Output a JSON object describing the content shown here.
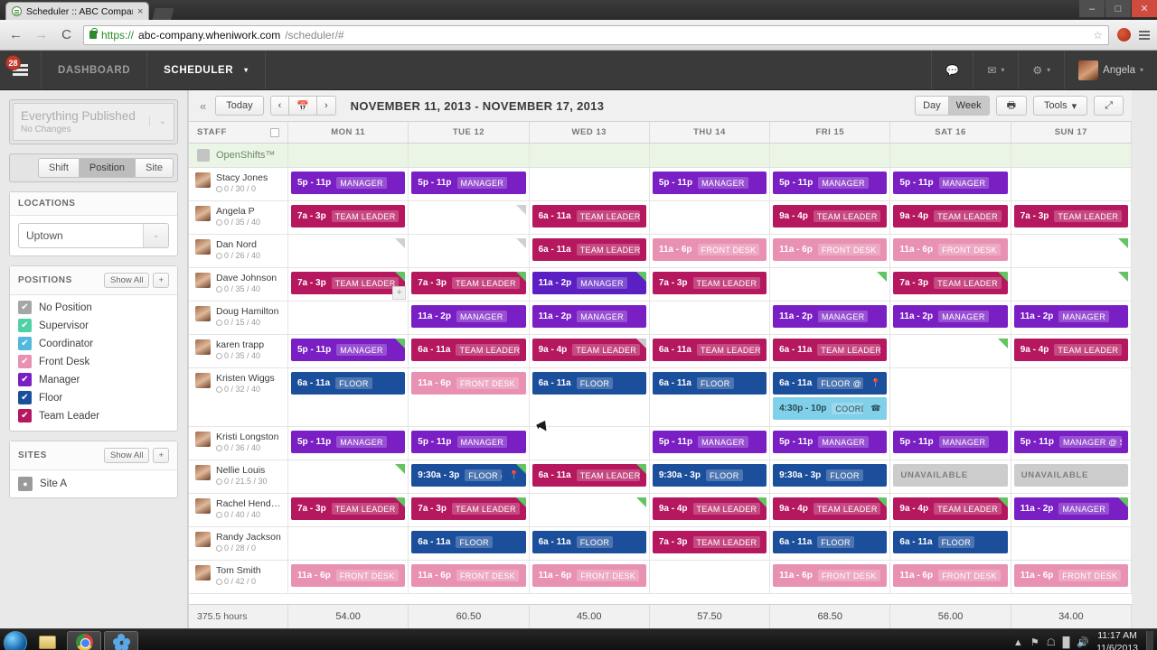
{
  "browser": {
    "tab_title": "Scheduler :: ABC Compan",
    "tab_close": "×",
    "url_scheme": "https://",
    "url_host": "abc-company.wheniwork.com",
    "url_path": "/scheduler/#",
    "back_icon": "←",
    "forward_icon": "→",
    "reload_icon": "C",
    "star_icon": "☆",
    "minimize": "–",
    "maximize": "□",
    "close": "✕"
  },
  "app_header": {
    "badge": "28",
    "nav": [
      {
        "label": "DASHBOARD",
        "active": false
      },
      {
        "label": "SCHEDULER",
        "active": true,
        "caret": "▾"
      }
    ],
    "chat_icon": "⌨",
    "inbox_icon": "✉",
    "gear_icon": "⚙",
    "caret": "▾",
    "user_name": "Angela"
  },
  "sidebar": {
    "publish": {
      "title": "Everything Published",
      "subtitle": "No Changes",
      "caret": "⌄"
    },
    "view_modes": [
      {
        "label": "Shift",
        "active": false
      },
      {
        "label": "Position",
        "active": true
      },
      {
        "label": "Site",
        "active": false
      }
    ],
    "locations": {
      "header": "LOCATIONS",
      "selected": "Uptown",
      "caret": "⌄"
    },
    "positions": {
      "header": "POSITIONS",
      "show_all": "Show All",
      "add": "+",
      "items": [
        {
          "label": "No Position",
          "color": "#a6a6a6",
          "checked": true
        },
        {
          "label": "Supervisor",
          "color": "#4fd0a5",
          "checked": true
        },
        {
          "label": "Coordinator",
          "color": "#52b8dd",
          "checked": true
        },
        {
          "label": "Front Desk",
          "color": "#e891b3",
          "checked": true
        },
        {
          "label": "Manager",
          "color": "#7a1fc4",
          "checked": true
        },
        {
          "label": "Floor",
          "color": "#1b4f9c",
          "checked": true
        },
        {
          "label": "Team Leader",
          "color": "#b5185e",
          "checked": true
        }
      ]
    },
    "sites": {
      "header": "SITES",
      "show_all": "Show All",
      "add": "+",
      "items": [
        {
          "label": "Site A",
          "icon": "📍"
        }
      ]
    }
  },
  "toolbar": {
    "collapse_icon": "«",
    "today": "Today",
    "prev": "‹",
    "next": "›",
    "calendar_icon": "▦",
    "date_range": "NOVEMBER 11, 2013 - NOVEMBER 17, 2013",
    "day": "Day",
    "week": "Week",
    "print_icon": "⎙",
    "tools": "Tools",
    "tools_caret": "▾",
    "expand_icon": "⤢"
  },
  "grid": {
    "staff_header": "STAFF",
    "days": [
      "MON 11",
      "TUE 12",
      "WED 13",
      "THU 14",
      "FRI 15",
      "SAT 16",
      "SUN 17"
    ],
    "open_shifts_label": "OpenShifts™",
    "clock_icon": "◴",
    "pin_icon": "📍",
    "phone_icon": "☎",
    "rows": [
      {
        "name": "Stacy Jones",
        "hours": "0 / 30 / 0",
        "cells": [
          {
            "shifts": [
              {
                "time": "5p - 11p",
                "position": "MANAGER",
                "color": "#7a1fc4"
              }
            ]
          },
          {
            "shifts": [
              {
                "time": "5p - 11p",
                "position": "MANAGER",
                "color": "#7a1fc4"
              }
            ]
          },
          {
            "shifts": []
          },
          {
            "shifts": [
              {
                "time": "5p - 11p",
                "position": "MANAGER",
                "color": "#7a1fc4"
              }
            ]
          },
          {
            "shifts": [
              {
                "time": "5p - 11p",
                "position": "MANAGER",
                "color": "#7a1fc4"
              }
            ]
          },
          {
            "shifts": [
              {
                "time": "5p - 11p",
                "position": "MANAGER",
                "color": "#7a1fc4"
              }
            ]
          },
          {
            "shifts": []
          }
        ]
      },
      {
        "name": "Angela P",
        "hours": "0 / 35 / 40",
        "cells": [
          {
            "shifts": [
              {
                "time": "7a - 3p",
                "position": "TEAM LEADER",
                "color": "#b5185e"
              }
            ]
          },
          {
            "shifts": [],
            "corner": "grey"
          },
          {
            "shifts": [
              {
                "time": "6a - 11a",
                "position": "TEAM LEADER",
                "color": "#b5185e"
              }
            ]
          },
          {
            "shifts": []
          },
          {
            "shifts": [
              {
                "time": "9a - 4p",
                "position": "TEAM LEADER",
                "color": "#b5185e"
              }
            ]
          },
          {
            "shifts": [
              {
                "time": "9a - 4p",
                "position": "TEAM LEADER",
                "color": "#b5185e"
              }
            ]
          },
          {
            "shifts": [
              {
                "time": "7a - 3p",
                "position": "TEAM LEADER",
                "color": "#b5185e"
              }
            ]
          }
        ]
      },
      {
        "name": "Dan Nord",
        "hours": "0 / 26 / 40",
        "cells": [
          {
            "shifts": [],
            "corner": "grey"
          },
          {
            "shifts": [],
            "corner": "grey"
          },
          {
            "shifts": [
              {
                "time": "6a - 11a",
                "position": "TEAM LEADER",
                "color": "#b5185e"
              }
            ]
          },
          {
            "shifts": [
              {
                "time": "11a - 6p",
                "position": "FRONT DESK",
                "color": "#e891b3"
              }
            ]
          },
          {
            "shifts": [
              {
                "time": "11a - 6p",
                "position": "FRONT DESK",
                "color": "#e891b3"
              }
            ]
          },
          {
            "shifts": [
              {
                "time": "11a - 6p",
                "position": "FRONT DESK",
                "color": "#e891b3"
              }
            ]
          },
          {
            "shifts": [],
            "corner": "green"
          }
        ]
      },
      {
        "name": "Dave Johnson",
        "hours": "0 / 35 / 40",
        "cells": [
          {
            "shifts": [
              {
                "time": "7a - 3p",
                "position": "TEAM LEADER",
                "color": "#b5185e",
                "corner": "green"
              }
            ],
            "add": "+"
          },
          {
            "shifts": [
              {
                "time": "7a - 3p",
                "position": "TEAM LEADER",
                "color": "#b5185e",
                "corner": "green"
              }
            ]
          },
          {
            "shifts": [
              {
                "time": "11a - 2p",
                "position": "MANAGER",
                "color": "#5b1fc4",
                "corner": "green"
              }
            ]
          },
          {
            "shifts": [
              {
                "time": "7a - 3p",
                "position": "TEAM LEADER",
                "color": "#b5185e"
              }
            ]
          },
          {
            "shifts": [],
            "corner": "green"
          },
          {
            "shifts": [
              {
                "time": "7a - 3p",
                "position": "TEAM LEADER",
                "color": "#b5185e",
                "corner": "green"
              }
            ]
          },
          {
            "shifts": [],
            "corner": "green"
          }
        ]
      },
      {
        "name": "Doug Hamilton",
        "hours": "0 / 15 / 40",
        "cells": [
          {
            "shifts": []
          },
          {
            "shifts": [
              {
                "time": "11a - 2p",
                "position": "MANAGER",
                "color": "#7a1fc4"
              }
            ]
          },
          {
            "shifts": [
              {
                "time": "11a - 2p",
                "position": "MANAGER",
                "color": "#7a1fc4"
              }
            ]
          },
          {
            "shifts": []
          },
          {
            "shifts": [
              {
                "time": "11a - 2p",
                "position": "MANAGER",
                "color": "#7a1fc4"
              }
            ]
          },
          {
            "shifts": [
              {
                "time": "11a - 2p",
                "position": "MANAGER",
                "color": "#7a1fc4"
              }
            ]
          },
          {
            "shifts": [
              {
                "time": "11a - 2p",
                "position": "MANAGER",
                "color": "#7a1fc4"
              }
            ]
          }
        ]
      },
      {
        "name": "karen trapp",
        "hours": "0 / 35 / 40",
        "cells": [
          {
            "shifts": [
              {
                "time": "5p - 11p",
                "position": "MANAGER",
                "color": "#7a1fc4",
                "corner": "green"
              }
            ]
          },
          {
            "shifts": [
              {
                "time": "6a - 11a",
                "position": "TEAM LEADER @ SIT",
                "color": "#b5185e"
              }
            ]
          },
          {
            "shifts": [
              {
                "time": "9a - 4p",
                "position": "TEAM LEADER",
                "color": "#b5185e",
                "corner": "grey"
              }
            ]
          },
          {
            "shifts": [
              {
                "time": "6a - 11a",
                "position": "TEAM LEADER",
                "color": "#b5185e"
              }
            ]
          },
          {
            "shifts": [
              {
                "time": "6a - 11a",
                "position": "TEAM LEADER",
                "color": "#b5185e"
              }
            ]
          },
          {
            "shifts": [],
            "corner": "green"
          },
          {
            "shifts": [
              {
                "time": "9a - 4p",
                "position": "TEAM LEADER",
                "color": "#b5185e"
              }
            ]
          }
        ]
      },
      {
        "name": "Kristen Wiggs",
        "hours": "0 / 32 / 40",
        "tall": true,
        "cells": [
          {
            "shifts": [
              {
                "time": "6a - 11a",
                "position": "FLOOR",
                "color": "#1b4f9c"
              }
            ]
          },
          {
            "shifts": [
              {
                "time": "11a - 6p",
                "position": "FRONT DESK",
                "color": "#e891b3"
              }
            ]
          },
          {
            "shifts": [
              {
                "time": "6a - 11a",
                "position": "FLOOR",
                "color": "#1b4f9c"
              }
            ]
          },
          {
            "shifts": [
              {
                "time": "6a - 11a",
                "position": "FLOOR",
                "color": "#1b4f9c"
              }
            ]
          },
          {
            "shifts": [
              {
                "time": "6a - 11a",
                "position": "FLOOR @ SITE A",
                "color": "#1b4f9c",
                "icon": "📍"
              },
              {
                "time": "4:30p - 10p",
                "position": "COORDINATOR",
                "color": "#7fd0e8",
                "icon": "☎",
                "dark_text": true
              }
            ]
          },
          {
            "shifts": []
          },
          {
            "shifts": []
          }
        ]
      },
      {
        "name": "Kristi Longston",
        "hours": "0 / 36 / 40",
        "cells": [
          {
            "shifts": [
              {
                "time": "5p - 11p",
                "position": "MANAGER",
                "color": "#7a1fc4"
              }
            ]
          },
          {
            "shifts": [
              {
                "time": "5p - 11p",
                "position": "MANAGER",
                "color": "#7a1fc4"
              }
            ]
          },
          {
            "shifts": []
          },
          {
            "shifts": [
              {
                "time": "5p - 11p",
                "position": "MANAGER",
                "color": "#7a1fc4"
              }
            ]
          },
          {
            "shifts": [
              {
                "time": "5p - 11p",
                "position": "MANAGER",
                "color": "#7a1fc4"
              }
            ]
          },
          {
            "shifts": [
              {
                "time": "5p - 11p",
                "position": "MANAGER",
                "color": "#7a1fc4"
              }
            ]
          },
          {
            "shifts": [
              {
                "time": "5p - 11p",
                "position": "MANAGER @ SITE A",
                "color": "#7a1fc4"
              }
            ]
          }
        ]
      },
      {
        "name": "Nellie Louis",
        "hours": "0 / 21.5 / 30",
        "cells": [
          {
            "shifts": [],
            "corner": "green"
          },
          {
            "shifts": [
              {
                "time": "9:30a - 3p",
                "position": "FLOOR @ SITE A",
                "color": "#1b4f9c",
                "icon": "📍",
                "corner": "green"
              }
            ]
          },
          {
            "shifts": [
              {
                "time": "6a - 11a",
                "position": "TEAM LEADER",
                "color": "#b5185e",
                "corner": "green"
              }
            ]
          },
          {
            "shifts": [
              {
                "time": "9:30a - 3p",
                "position": "FLOOR",
                "color": "#1b4f9c"
              }
            ]
          },
          {
            "shifts": [
              {
                "time": "9:30a - 3p",
                "position": "FLOOR",
                "color": "#1b4f9c"
              }
            ]
          },
          {
            "shifts": [
              {
                "unavailable": "UNAVAILABLE"
              }
            ]
          },
          {
            "shifts": [
              {
                "unavailable": "UNAVAILABLE"
              }
            ]
          }
        ]
      },
      {
        "name": "Rachel Henderson",
        "hours": "0 / 40 / 40",
        "cells": [
          {
            "shifts": [
              {
                "time": "7a - 3p",
                "position": "TEAM LEADER @ SITE",
                "color": "#b5185e",
                "corner": "green"
              }
            ]
          },
          {
            "shifts": [
              {
                "time": "7a - 3p",
                "position": "TEAM LEADER",
                "color": "#b5185e",
                "corner": "green"
              }
            ]
          },
          {
            "shifts": [],
            "corner": "green"
          },
          {
            "shifts": [
              {
                "time": "9a - 4p",
                "position": "TEAM LEADER",
                "color": "#b5185e",
                "corner": "green"
              }
            ]
          },
          {
            "shifts": [
              {
                "time": "9a - 4p",
                "position": "TEAM LEADER @ SITE",
                "color": "#b5185e",
                "corner": "green"
              }
            ]
          },
          {
            "shifts": [
              {
                "time": "9a - 4p",
                "position": "TEAM LEADER",
                "color": "#b5185e",
                "corner": "green"
              }
            ]
          },
          {
            "shifts": [
              {
                "time": "11a - 2p",
                "position": "MANAGER",
                "color": "#7a1fc4",
                "corner": "green"
              }
            ]
          }
        ]
      },
      {
        "name": "Randy Jackson",
        "hours": "0 / 28 / 0",
        "cells": [
          {
            "shifts": []
          },
          {
            "shifts": [
              {
                "time": "6a - 11a",
                "position": "FLOOR",
                "color": "#1b4f9c"
              }
            ]
          },
          {
            "shifts": [
              {
                "time": "6a - 11a",
                "position": "FLOOR",
                "color": "#1b4f9c"
              }
            ]
          },
          {
            "shifts": [
              {
                "time": "7a - 3p",
                "position": "TEAM LEADER",
                "color": "#b5185e"
              }
            ]
          },
          {
            "shifts": [
              {
                "time": "6a - 11a",
                "position": "FLOOR",
                "color": "#1b4f9c"
              }
            ]
          },
          {
            "shifts": [
              {
                "time": "6a - 11a",
                "position": "FLOOR",
                "color": "#1b4f9c"
              }
            ]
          },
          {
            "shifts": []
          }
        ]
      },
      {
        "name": "Tom Smith",
        "hours": "0 / 42 / 0",
        "cells": [
          {
            "shifts": [
              {
                "time": "11a - 6p",
                "position": "FRONT DESK",
                "color": "#e891b3"
              }
            ]
          },
          {
            "shifts": [
              {
                "time": "11a - 6p",
                "position": "FRONT DESK",
                "color": "#e891b3"
              }
            ]
          },
          {
            "shifts": [
              {
                "time": "11a - 6p",
                "position": "FRONT DESK",
                "color": "#e891b3"
              }
            ]
          },
          {
            "shifts": []
          },
          {
            "shifts": [
              {
                "time": "11a - 6p",
                "position": "FRONT DESK",
                "color": "#e891b3"
              }
            ]
          },
          {
            "shifts": [
              {
                "time": "11a - 6p",
                "position": "FRONT DESK",
                "color": "#e891b3"
              }
            ]
          },
          {
            "shifts": [
              {
                "time": "11a - 6p",
                "position": "FRONT DESK",
                "color": "#e891b3"
              }
            ]
          }
        ]
      }
    ],
    "totals": {
      "label": "375.5 hours",
      "values": [
        "54.00",
        "60.50",
        "45.00",
        "57.50",
        "68.50",
        "56.00",
        "34.00"
      ]
    }
  },
  "taskbar": {
    "tray_arrow": "▲",
    "network_icon": "▐",
    "volume_icon": "🔈",
    "time": "11:17 AM",
    "date": "11/6/2013"
  }
}
